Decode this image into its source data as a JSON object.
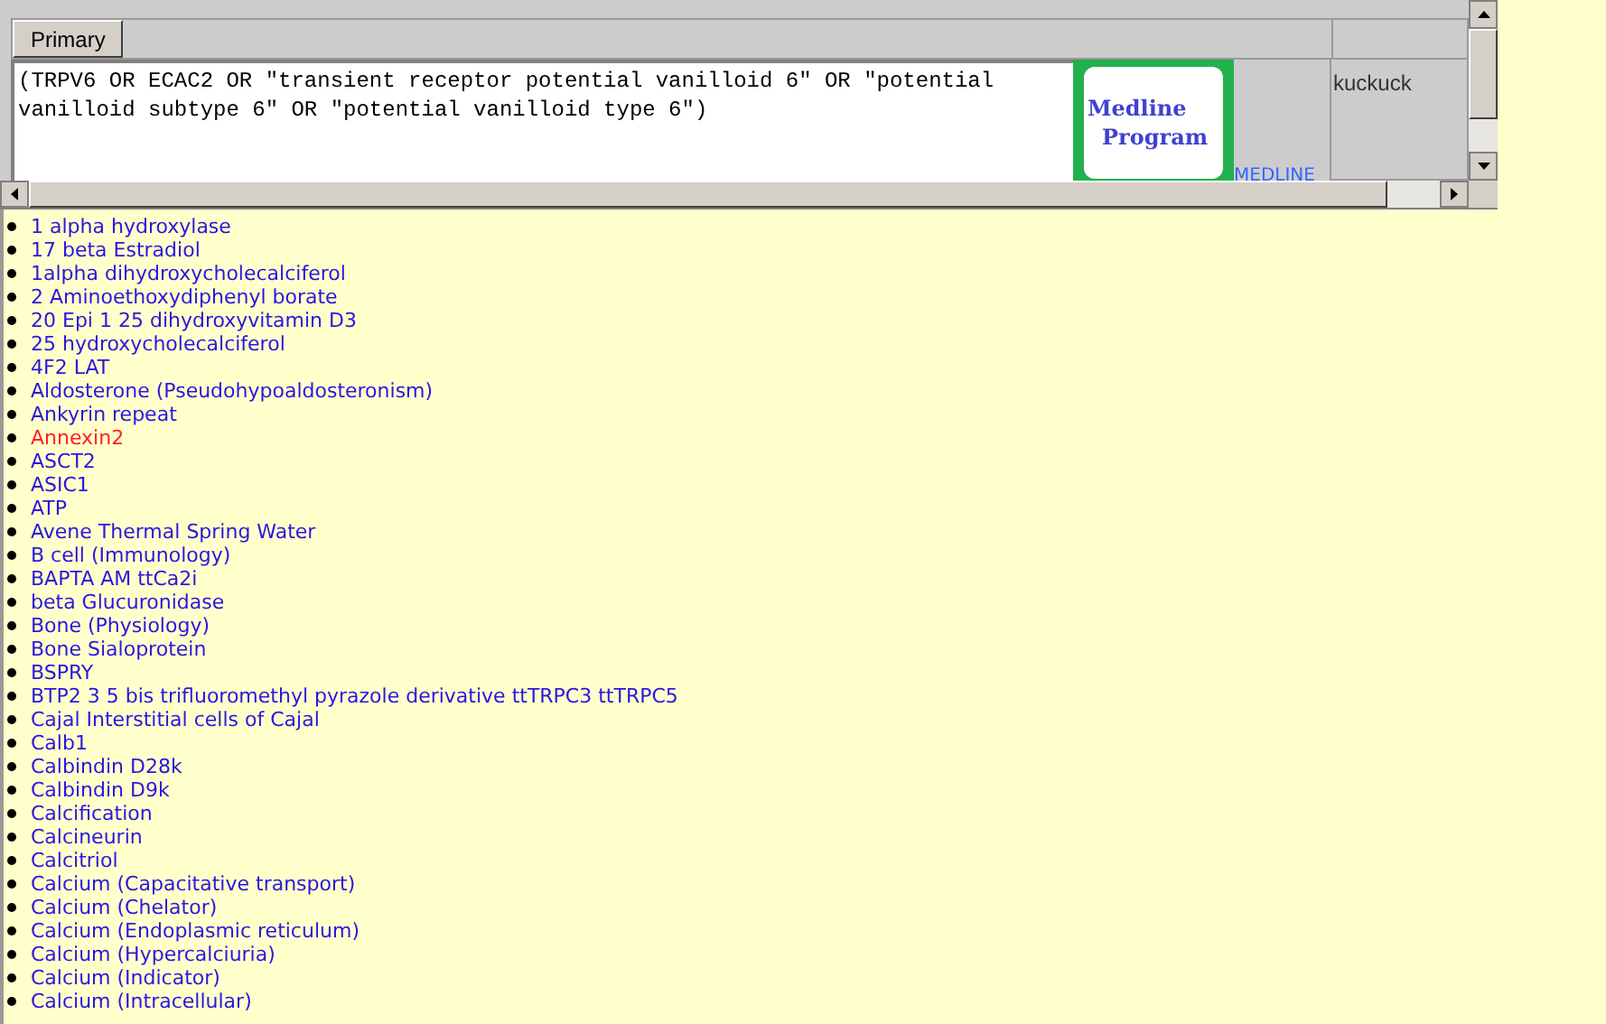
{
  "toolbar": {
    "tab_button": "Primary"
  },
  "query": {
    "value": "(TRPV6 OR ECAC2 OR \"transient receptor potential vanilloid 6\" OR \"potential vanilloid subtype 6\" OR \"potential vanilloid type 6\")"
  },
  "logo": {
    "line_1": "Medline",
    "line_2": "Program"
  },
  "medline_link": "MEDLINE",
  "side_label": "kuckuck",
  "topics": [
    {
      "label": "1 alpha hydroxylase",
      "highlighted": false
    },
    {
      "label": "17 beta Estradiol",
      "highlighted": false
    },
    {
      "label": "1alpha dihydroxycholecalciferol",
      "highlighted": false
    },
    {
      "label": "2 Aminoethoxydiphenyl borate",
      "highlighted": false
    },
    {
      "label": "20 Epi 1 25 dihydroxyvitamin D3",
      "highlighted": false
    },
    {
      "label": "25 hydroxycholecalciferol",
      "highlighted": false
    },
    {
      "label": "4F2 LAT",
      "highlighted": false
    },
    {
      "label": "Aldosterone (Pseudohypoaldosteronism)",
      "highlighted": false
    },
    {
      "label": "Ankyrin repeat",
      "highlighted": false
    },
    {
      "label": "Annexin2",
      "highlighted": true
    },
    {
      "label": "ASCT2",
      "highlighted": false
    },
    {
      "label": "ASIC1",
      "highlighted": false
    },
    {
      "label": "ATP",
      "highlighted": false
    },
    {
      "label": "Avene Thermal Spring Water",
      "highlighted": false
    },
    {
      "label": "B cell (Immunology)",
      "highlighted": false
    },
    {
      "label": "BAPTA AM ttCa2i",
      "highlighted": false
    },
    {
      "label": "beta Glucuronidase",
      "highlighted": false
    },
    {
      "label": "Bone (Physiology)",
      "highlighted": false
    },
    {
      "label": "Bone Sialoprotein",
      "highlighted": false
    },
    {
      "label": "BSPRY",
      "highlighted": false
    },
    {
      "label": "BTP2 3 5 bis trifluoromethyl pyrazole derivative ttTRPC3 ttTRPC5",
      "highlighted": false
    },
    {
      "label": "Cajal Interstitial cells of Cajal",
      "highlighted": false
    },
    {
      "label": "Calb1",
      "highlighted": false
    },
    {
      "label": "Calbindin D28k",
      "highlighted": false
    },
    {
      "label": "Calbindin D9k",
      "highlighted": false
    },
    {
      "label": "Calcification",
      "highlighted": false
    },
    {
      "label": "Calcineurin",
      "highlighted": false
    },
    {
      "label": "Calcitriol",
      "highlighted": false
    },
    {
      "label": "Calcium (Capacitative transport)",
      "highlighted": false
    },
    {
      "label": "Calcium (Chelator)",
      "highlighted": false
    },
    {
      "label": "Calcium (Endoplasmic reticulum)",
      "highlighted": false
    },
    {
      "label": "Calcium (Hypercalciuria)",
      "highlighted": false
    },
    {
      "label": "Calcium (Indicator)",
      "highlighted": false
    },
    {
      "label": "Calcium (Intracellular)",
      "highlighted": false
    }
  ]
}
